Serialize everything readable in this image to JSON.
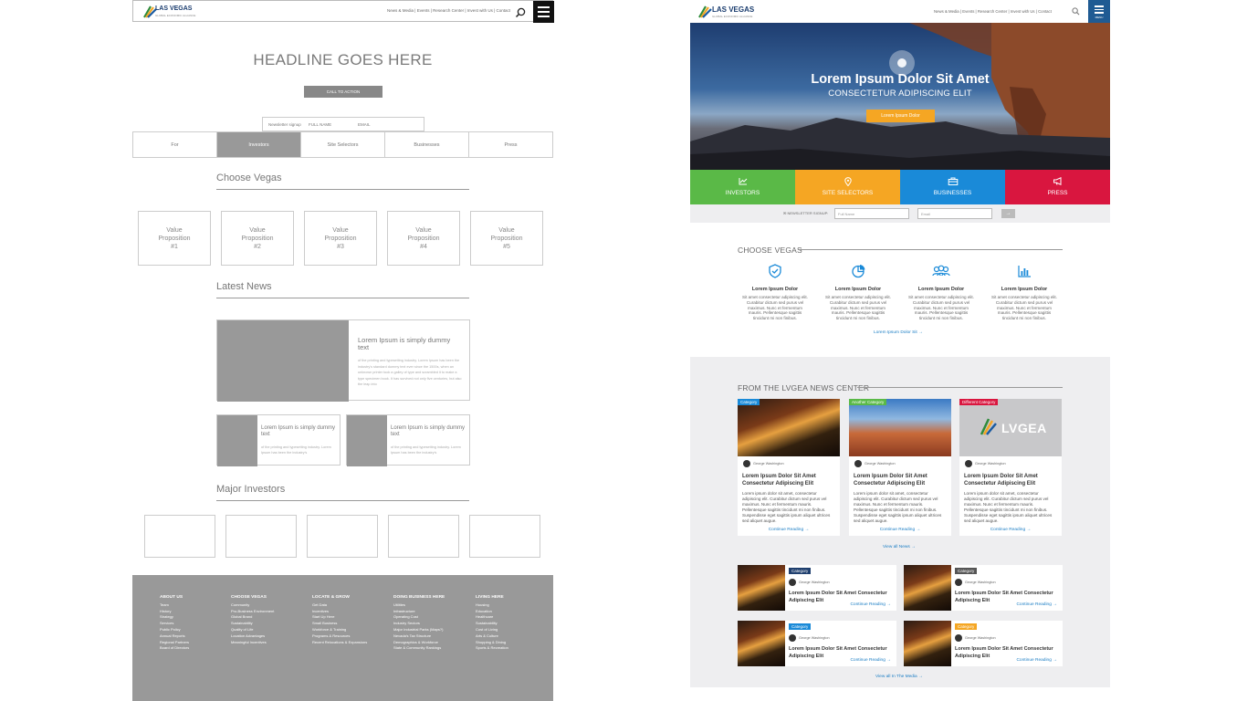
{
  "wireframe": {
    "logo": {
      "name": "LAS VEGAS",
      "tagline": "GLOBAL ECONOMIC ALLIANCE"
    },
    "nav_links": "News & Media | Events | Research Center | Invest with Us | Contact",
    "headline": "HEADLINE GOES HERE",
    "cta": "CALL TO ACTION",
    "newsletter": {
      "label": "Newsletter signup",
      "name_placeholder": "FULL NAME",
      "email_placeholder": "EMAIL"
    },
    "tabs": [
      "For",
      "Investors",
      "Site Selectors",
      "Businesses",
      "Press"
    ],
    "choose_title": "Choose Vegas",
    "value_props": [
      {
        "l1": "Value",
        "l2": "Proposition",
        "l3": "#1"
      },
      {
        "l1": "Value",
        "l2": "Proposition",
        "l3": "#2"
      },
      {
        "l1": "Value",
        "l2": "Proposition",
        "l3": "#3"
      },
      {
        "l1": "Value",
        "l2": "Proposition",
        "l3": "#4"
      },
      {
        "l1": "Value",
        "l2": "Proposition",
        "l3": "#5"
      }
    ],
    "news_title": "Latest News",
    "news_big": {
      "title": "Lorem Ipsum is simply dummy text",
      "body": "of the printing and typesetting industry. Lorem Ipsum has been the industry's standard dummy text ever since the 1500s, when an unknown printer took a galley of type and scrambled it to make a type specimen book. It has survived not only five centuries, but also the leap into"
    },
    "news_small": [
      {
        "title": "Lorem Ipsum is simply dummy text",
        "body": "of the printing and typesetting industry. Lorem Ipsum has been the industry's"
      },
      {
        "title": "Lorem Ipsum is simply dummy text",
        "body": "of the printing and typesetting industry. Lorem Ipsum has been the industry's"
      }
    ],
    "investors_title": "Major Investors",
    "footer": [
      {
        "head": "ABOUT US",
        "items": [
          "Team",
          "History",
          "Strategy",
          "Services",
          "Public Policy",
          "Annual Reports",
          "Regional Partners",
          "Board of Directors"
        ]
      },
      {
        "head": "CHOOSE VEGAS",
        "items": [
          "Community",
          "Pro-Business Environment",
          "Global Brand",
          "Sustainability",
          "Quality of Life",
          "Location Advantages",
          "Meaningful Incentives"
        ]
      },
      {
        "head": "LOCATE & GROW",
        "items": [
          "Get Data",
          "Incentives",
          "Start Up Here",
          "Small Business",
          "Workforce & Training",
          "Programs & Resources",
          "Recent Relocations & Expansions"
        ]
      },
      {
        "head": "DOING BUSINESS HERE",
        "items": [
          "Utilities",
          "Infrastructure",
          "Operating Cost",
          "Industry Sectors",
          "Major Industrial Parks (Maps?)",
          "Nevada's Tax Structure",
          "Demographics & Workforce",
          "State & Community Rankings"
        ]
      },
      {
        "head": "LIVING HERE",
        "items": [
          "Housing",
          "Education",
          "Healthcare",
          "Sustainability",
          "Cost of Living",
          "Arts & Culture",
          "Shopping & Dining",
          "Sports & Recreation"
        ]
      }
    ]
  },
  "design": {
    "logo": {
      "name": "LAS VEGAS",
      "tagline": "GLOBAL ECONOMIC ALLIANCE"
    },
    "nav_links": "News & Media  |  Events  |  Research Center  |  Invest with Us  |  Contact",
    "menu_label": "MENU",
    "hero": {
      "title": "Lorem Ipsum Dolor Sit Amet",
      "subtitle": "CONSECTETUR ADIPISCING ELIT",
      "button": "Lorem Ipsum Dolor"
    },
    "tabs": [
      {
        "label": "INVESTORS",
        "color": "#5ab947",
        "icon": "chart-icon"
      },
      {
        "label": "SITE SELECTORS",
        "color": "#f5a623",
        "icon": "map-pin-icon"
      },
      {
        "label": "BUSINESSES",
        "color": "#1a8ad8",
        "icon": "briefcase-icon"
      },
      {
        "label": "PRESS",
        "color": "#d9163f",
        "icon": "megaphone-icon"
      }
    ],
    "newsletter": {
      "label": "NEWSLETTER SIGNUP:",
      "name_placeholder": "Full Name",
      "email_placeholder": "Email",
      "go": "→"
    },
    "choose_title": "CHOOSE VEGAS",
    "choose_items": [
      {
        "title": "Lorem Ipsum Dolor",
        "body": "Sit amet consectetur adipiscing elit. Curabitur dictum sed purus vel maximus. Nunc et fermentum mauris. Pellentesque sagittis tincidunt mi non finibus.",
        "icon": "shield-icon"
      },
      {
        "title": "Lorem Ipsum Dolor",
        "body": "Sit amet consectetur adipiscing elit. Curabitur dictum sed purus vel maximus. Nunc et fermentum mauris. Pellentesque sagittis tincidunt mi non finibus.",
        "icon": "pie-chart-icon"
      },
      {
        "title": "Lorem Ipsum Dolor",
        "body": "Sit amet consectetur adipiscing elit. Curabitur dictum sed purus vel maximus. Nunc et fermentum mauris. Pellentesque sagittis tincidunt mi non finibus.",
        "icon": "people-icon"
      },
      {
        "title": "Lorem Ipsum Dolor",
        "body": "Sit amet consectetur adipiscing elit. Curabitur dictum sed purus vel maximus. Nunc et fermentum mauris. Pellentesque sagittis tincidunt mi non finibus.",
        "icon": "bar-chart-icon"
      }
    ],
    "choose_link": "Lorem Ipsum Dolor Sit →",
    "news_title": "FROM THE LVGEA NEWS CENTER",
    "cards": [
      {
        "category": "Category",
        "cat_color": "#1a8ad8",
        "author": "George Washington",
        "title": "Lorem Ipsum Dolor Sit Amet Consectetur Adipiscing Elit",
        "body": "Lorem ipsum dolor sit amet, consectetur adipiscing elit. Curabitur dictum sed purus vel maximus. Nunc et fermentum mauris. Pellentesque sagittis tincidunt mi non finibus. Suspendisse eget sagittis ipsum aliquet ultrices sed aliquet augue.",
        "more": "Continue Reading →"
      },
      {
        "category": "Another Category",
        "cat_color": "#5ab947",
        "author": "George Washington",
        "title": "Lorem Ipsum Dolor Sit Amet Consectetur Adipiscing Elit",
        "body": "Lorem ipsum dolor sit amet, consectetur adipiscing elit. Curabitur dictum sed purus vel maximus. Nunc et fermentum mauris. Pellentesque sagittis tincidunt mi non finibus. Suspendisse eget sagittis ipsum aliquet ultrices sed aliquet augue.",
        "more": "Continue Reading →"
      },
      {
        "category": "Different Category",
        "cat_color": "#d9163f",
        "author": "George Washington",
        "title": "Lorem Ipsum Dolor Sit Amet Consectetur Adipiscing Elit",
        "body": "Lorem ipsum dolor sit amet, consectetur adipiscing elit. Curabitur dictum sed purus vel maximus. Nunc et fermentum mauris. Pellentesque sagittis tincidunt mi non finibus. Suspendisse eget sagittis ipsum aliquet ultrices sed aliquet augue.",
        "more": "Continue Reading →",
        "logo_text": "LVGEA"
      }
    ],
    "view_all_news": "View all News →",
    "rows": [
      {
        "category": "Category",
        "cat_color": "#1f3f6e",
        "author": "George Washington",
        "title": "Lorem Ipsum Dolor Sit Amet Consectetur Adipiscing Elit",
        "more": "Continue Reading →"
      },
      {
        "category": "Category",
        "cat_color": "#555555",
        "author": "George Washington",
        "title": "Lorem Ipsum Dolor Sit Amet Consectetur Adipiscing Elit",
        "more": "Continue Reading →"
      },
      {
        "category": "Category",
        "cat_color": "#1a8ad8",
        "author": "George Washington",
        "title": "Lorem Ipsum Dolor Sit Amet Consectetur Adipiscing Elit",
        "more": "Continue Reading →"
      },
      {
        "category": "Category",
        "cat_color": "#f5a623",
        "author": "George Washington",
        "title": "Lorem Ipsum Dolor Sit Amet Consectetur Adipiscing Elit",
        "more": "Continue Reading →"
      }
    ],
    "view_all_media": "View all In The Media →"
  }
}
